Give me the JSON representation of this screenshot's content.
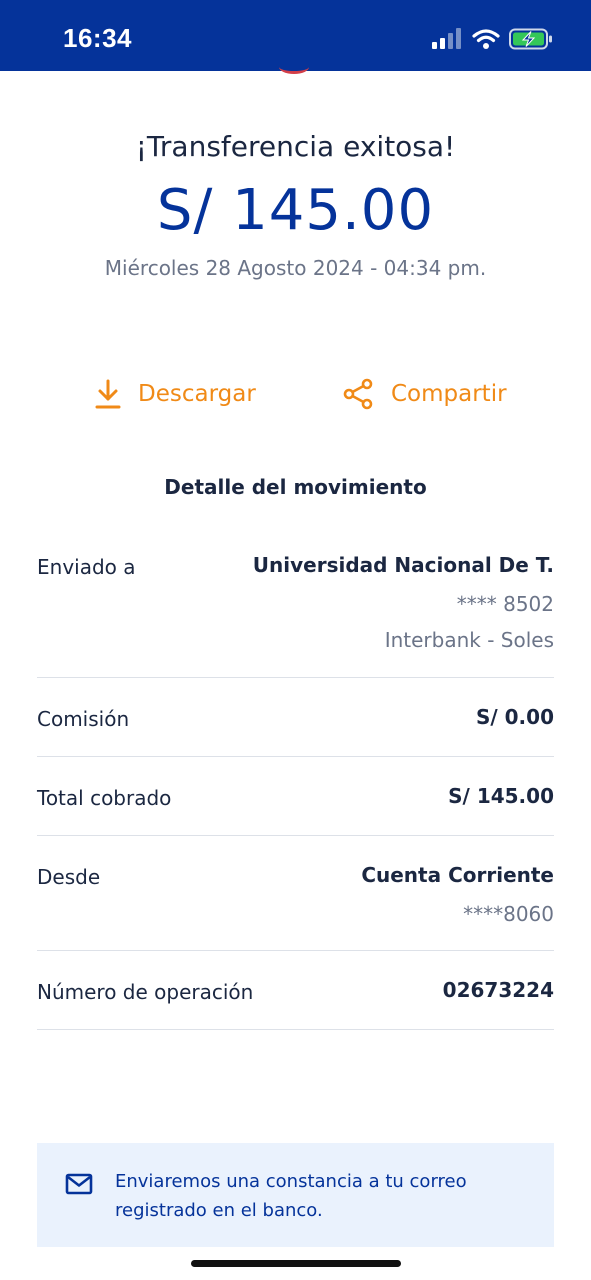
{
  "status_bar": {
    "time": "16:34",
    "icons": [
      "cellular-signal-icon",
      "wifi-icon",
      "battery-charging-icon"
    ],
    "background": "#05339a"
  },
  "header": {
    "title": "¡Transferencia exitosa!",
    "amount": "S/ 145.00",
    "datetime": "Miércoles 28 Agosto 2024 - 04:34 pm."
  },
  "actions": {
    "download_label": "Descargar",
    "share_label": "Compartir",
    "accent_color": "#f08a17"
  },
  "details": {
    "title": "Detalle del movimiento",
    "sent_to": {
      "label": "Enviado a",
      "name": "Universidad Nacional De T.",
      "account": "**** 8502",
      "bank": "Interbank - Soles"
    },
    "commission": {
      "label": "Comisión",
      "value": "S/ 0.00"
    },
    "total": {
      "label": "Total cobrado",
      "value": "S/ 145.00"
    },
    "from": {
      "label": "Desde",
      "account_type": "Cuenta Corriente",
      "account": "****8060"
    },
    "operation": {
      "label": "Número de operación",
      "value": "02673224"
    }
  },
  "notice": {
    "icon": "mail-icon",
    "text_line1": "Enviaremos una constancia a tu correo",
    "text_line2": "registrado en el banco."
  }
}
